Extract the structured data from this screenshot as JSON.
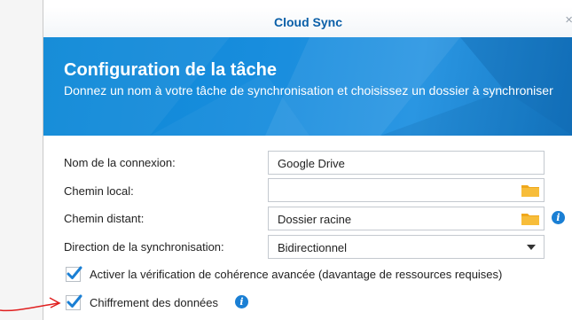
{
  "window": {
    "title": "Cloud Sync",
    "close_glyph": "×"
  },
  "header": {
    "title": "Configuration de la tâche",
    "subtitle": "Donnez un nom à votre tâche de synchronisation et choisissez un dossier à synchroniser"
  },
  "form": {
    "connection_name": {
      "label": "Nom de la connexion:",
      "value": "Google Drive"
    },
    "local_path": {
      "label": "Chemin local:",
      "value": "",
      "icon": "folder-icon"
    },
    "remote_path": {
      "label": "Chemin distant:",
      "value": "Dossier racine",
      "icon": "folder-icon",
      "info_icon": "info-icon"
    },
    "sync_direction": {
      "label": "Direction de la synchronisation:",
      "value": "Bidirectionnel"
    },
    "advanced_check": {
      "label": "Activer la vérification de cohérence avancée (davantage de ressources requises)",
      "checked": true
    },
    "encryption": {
      "label": "Chiffrement des données",
      "checked": true,
      "info_icon": "info-icon"
    }
  },
  "colors": {
    "accent": "#0a5fa8",
    "banner": "#1a8ede",
    "check": "#1a7fd4",
    "annotation": "#e02020"
  },
  "info_glyph": "i"
}
